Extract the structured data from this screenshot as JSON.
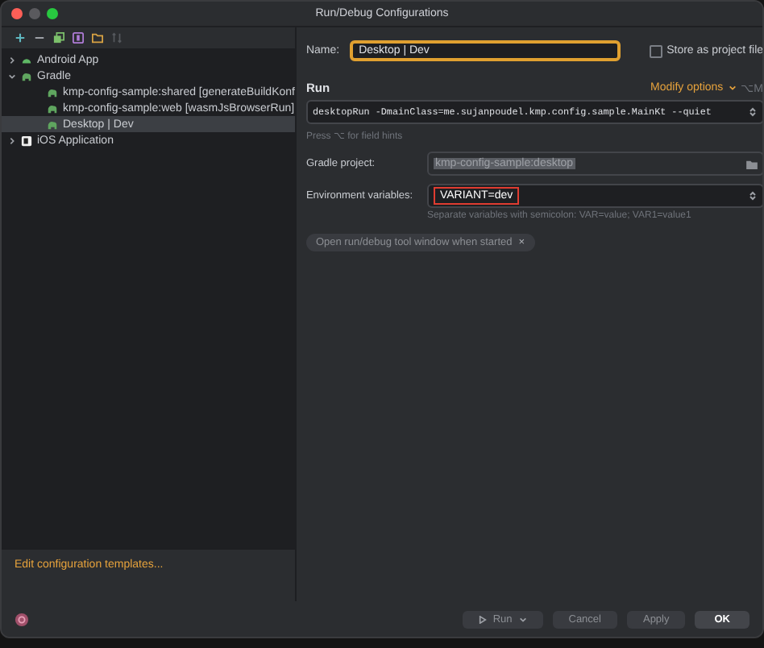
{
  "window": {
    "title": "Run/Debug Configurations"
  },
  "tree": [
    {
      "label": "Android App",
      "kind": "android",
      "expanded": false,
      "selected": false
    },
    {
      "label": "Gradle",
      "kind": "gradle",
      "expanded": true,
      "selected": false,
      "children": [
        {
          "label": "kmp-config-sample:shared [generateBuildKonf",
          "kind": "gradle",
          "selected": false
        },
        {
          "label": "kmp-config-sample:web [wasmJsBrowserRun]",
          "kind": "gradle",
          "selected": false
        },
        {
          "label": "Desktop | Dev",
          "kind": "gradle",
          "selected": true
        }
      ]
    },
    {
      "label": "iOS Application",
      "kind": "ios",
      "expanded": false,
      "selected": false
    }
  ],
  "edit_templates_link": "Edit configuration templates...",
  "name_label": "Name:",
  "name_value": "Desktop | Dev",
  "store_as_project_file": {
    "label": "Store as project file",
    "checked": false
  },
  "run_heading": "Run",
  "modify_options": "Modify options",
  "modify_shortcut": "⌥M",
  "command": "desktopRun -DmainClass=me.sujanpoudel.kmp.config.sample.MainKt --quiet",
  "command_hint": "Press ⌥ for field hints",
  "gradle_project": {
    "label": "Gradle project:",
    "value": "kmp-config-sample:desktop"
  },
  "env_vars": {
    "label": "Environment variables:",
    "value": "VARIANT=dev",
    "hint": "Separate variables with semicolon: VAR=value; VAR1=value1"
  },
  "chip": {
    "label": "Open run/debug tool window when started",
    "close": "×"
  },
  "buttons": [
    {
      "label": "Run",
      "kind": "run"
    },
    {
      "label": "Cancel",
      "kind": "plain"
    },
    {
      "label": "Apply",
      "kind": "plain"
    },
    {
      "label": "OK",
      "kind": "default"
    }
  ]
}
